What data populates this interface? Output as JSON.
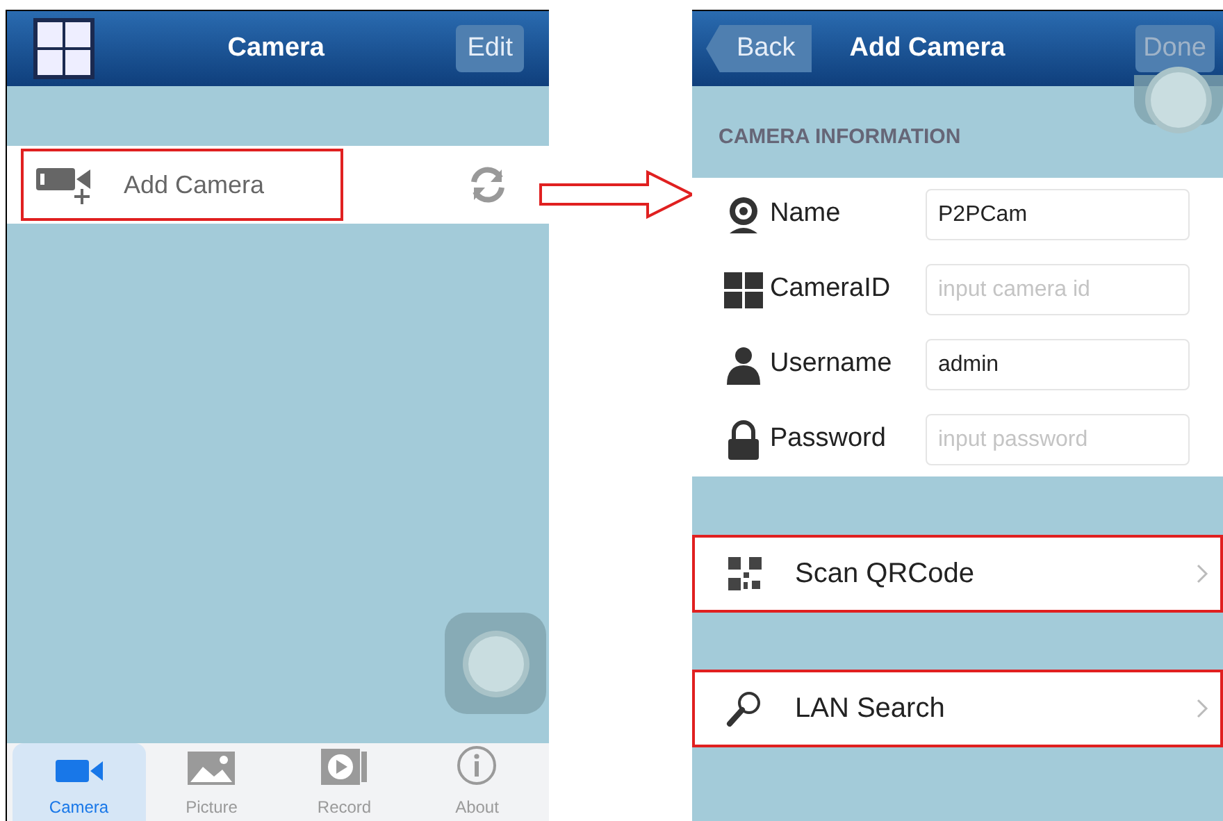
{
  "left_screen": {
    "title": "Camera",
    "edit_button": "Edit",
    "add_camera_row": {
      "label": "Add Camera",
      "highlighted": true
    },
    "tabs": [
      {
        "label": "Camera",
        "kind": "camera",
        "selected": true
      },
      {
        "label": "Picture",
        "kind": "picture",
        "selected": false
      },
      {
        "label": "Record",
        "kind": "record",
        "selected": false
      },
      {
        "label": "About",
        "kind": "about",
        "selected": false
      }
    ]
  },
  "right_screen": {
    "back_button": "Back",
    "title": "Add Camera",
    "done_button": "Done",
    "section_header": "CAMERA INFORMATION",
    "fields": [
      {
        "label": "Name",
        "kind": "webcam",
        "value": "P2PCam"
      },
      {
        "label": "CameraID",
        "kind": "grid",
        "placeholder": "input camera id"
      },
      {
        "label": "Username",
        "kind": "user",
        "value": "admin"
      },
      {
        "label": "Password",
        "kind": "lock",
        "placeholder": "input password"
      }
    ],
    "actions": [
      {
        "label": "Scan QRCode",
        "kind": "qr",
        "highlighted": true
      },
      {
        "label": "LAN Search",
        "kind": "search",
        "highlighted": true
      }
    ]
  }
}
